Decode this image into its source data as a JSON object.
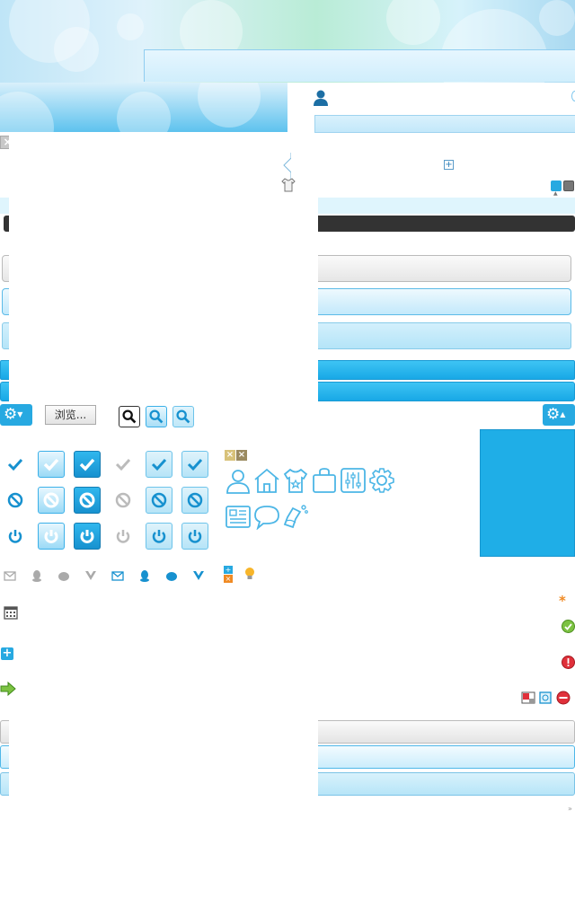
{
  "toolbar": {
    "browse_label": "浏览..."
  },
  "icons": {
    "user": "user-icon",
    "close": "close-icon",
    "chevron": "chevron-right-icon",
    "minus": "minus-square-icon",
    "plus": "plus-square-icon",
    "shirt": "shirt-icon",
    "gear": "gear-icon",
    "search": "search-icon",
    "check": "check-icon",
    "ban": "ban-icon",
    "power": "power-icon",
    "mail": "mail-icon",
    "qq": "qq-icon",
    "weibo": "weibo-icon",
    "vine": "vine-icon",
    "calendar": "calendar-icon",
    "add": "add-icon",
    "arrow_right": "arrow-right-icon",
    "asterisk": "required-asterisk-icon",
    "ok": "ok-icon",
    "error": "error-icon",
    "bulb": "lightbulb-icon",
    "delete": "delete-icon"
  },
  "colors": {
    "accent": "#27a9e1",
    "accent_dark": "#1791cf",
    "light_blue": "#dff5fd",
    "dark_bar": "#333333",
    "success": "#7cc242",
    "error": "#e0303a",
    "asterisk": "#f08a24"
  }
}
